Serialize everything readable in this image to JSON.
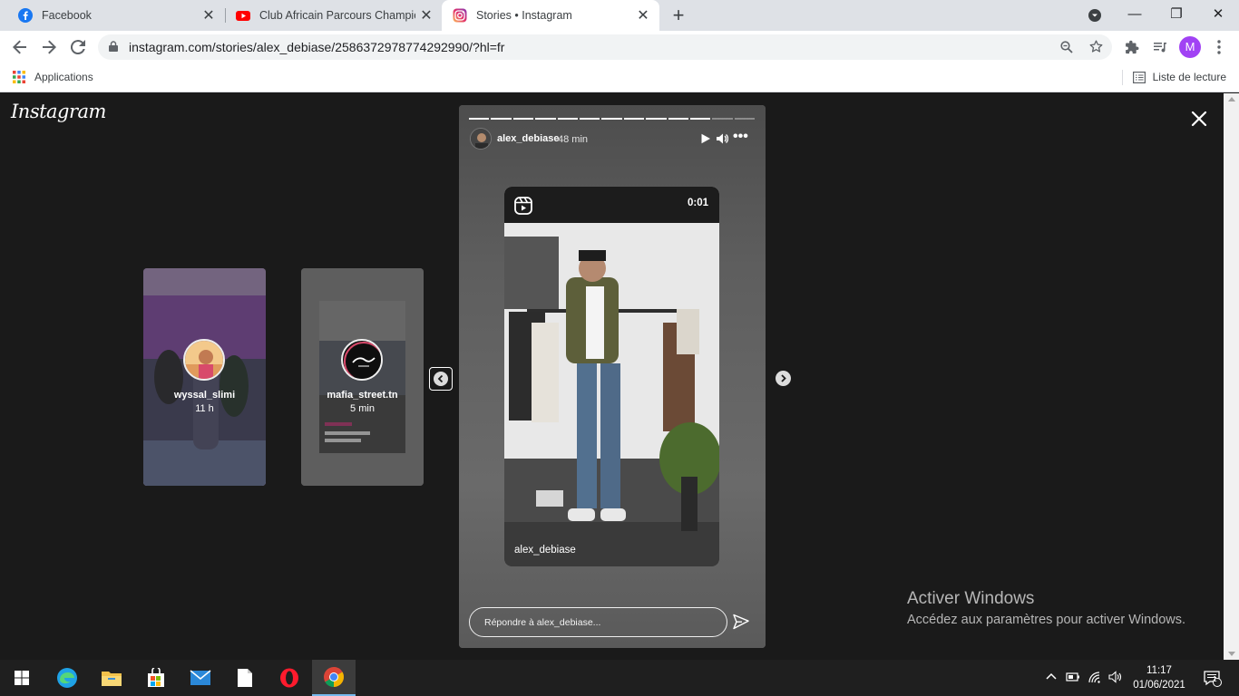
{
  "browser": {
    "tabs": [
      {
        "title": "Facebook",
        "icon": "facebook-icon",
        "active": false
      },
      {
        "title": "Club Africain Parcours Champion",
        "icon": "youtube-icon",
        "active": false
      },
      {
        "title": "Stories • Instagram",
        "icon": "instagram-icon",
        "active": true
      }
    ],
    "url": "instagram.com/stories/alex_debiase/2586372978774292990/?hl=fr",
    "profile_initial": "M",
    "bookmarks": {
      "apps_label": "Applications",
      "reading_list_label": "Liste de lecture"
    }
  },
  "instagram": {
    "logo": "Instagram",
    "previews": [
      {
        "username": "wyssal_slimi",
        "time": "11 h"
      },
      {
        "username": "mafia_street.tn",
        "time": "5 min"
      }
    ],
    "story": {
      "username": "alex_debiase",
      "time": "48 min",
      "progress_total": 13,
      "progress_done": 11,
      "video_time": "0:01",
      "video_caption": "alex_debiase",
      "reply_placeholder": "Répondre à alex_debiase..."
    }
  },
  "windows_watermark": {
    "title": "Activer Windows",
    "subtitle": "Accédez aux paramètres pour activer Windows."
  },
  "taskbar": {
    "time": "11:17",
    "date": "01/06/2021",
    "notification_count": "1",
    "apps": [
      "start-button",
      "edge-icon",
      "file-explorer-icon",
      "store-icon",
      "mail-icon",
      "notepad-icon",
      "opera-icon",
      "chrome-icon"
    ]
  },
  "colors": {
    "instagram_bg": "#1a1a1a",
    "profile_avatar": "#a142f4",
    "taskbar_bg": "#1f1f1f",
    "youtube_red": "#ff0000",
    "facebook_blue": "#1877f2"
  }
}
